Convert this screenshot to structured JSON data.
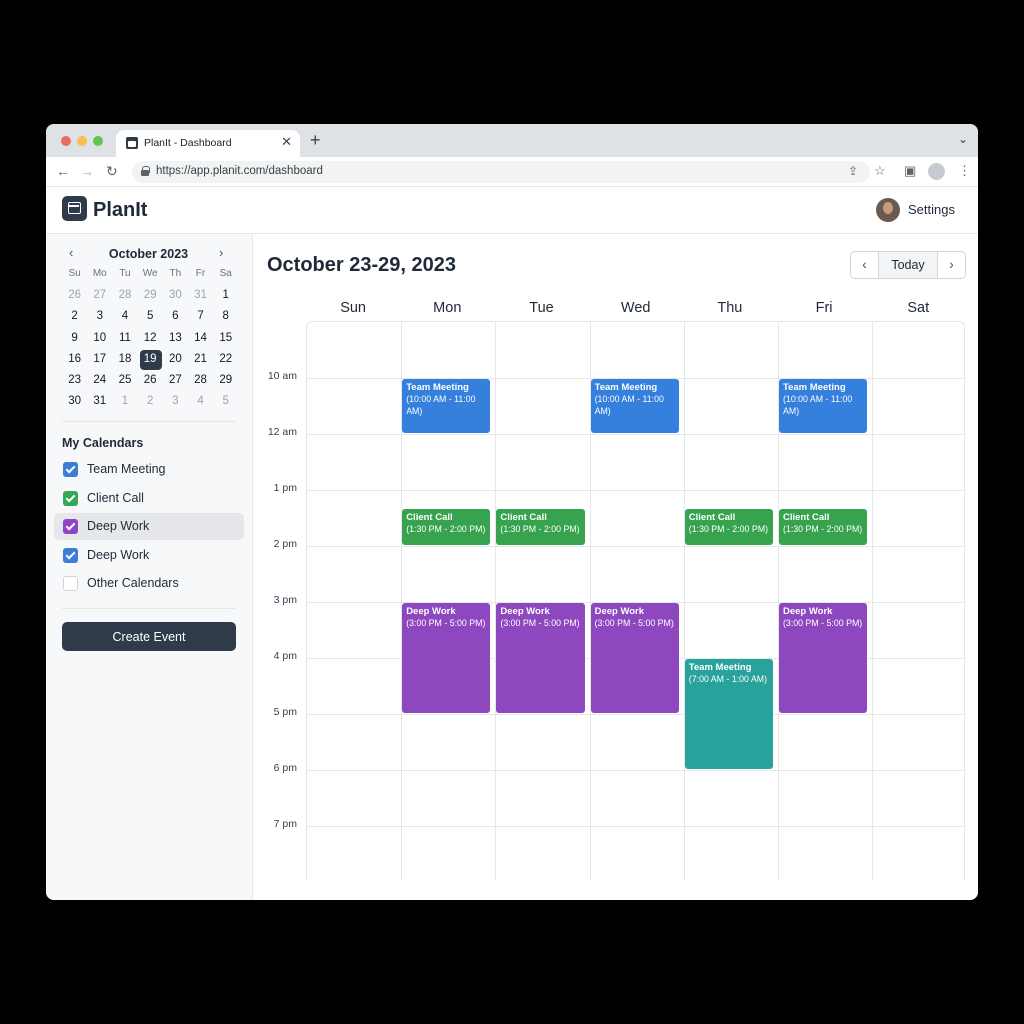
{
  "browser": {
    "tab_title": "PlanIt - Dashboard",
    "tab_close": "✕",
    "new_tab": "+",
    "tab_menu": "⌄",
    "url": "https://app.planit.com/dashboard",
    "back": "←",
    "forward": "→",
    "reload": "↻",
    "share": "⇪",
    "bookmark": "☆",
    "sidepanel": "▣",
    "menu": "⋮"
  },
  "app": {
    "name": "PlanIt",
    "settings_label": "Settings"
  },
  "mini_calendar": {
    "prev": "‹",
    "next": "›",
    "title": "October 2023",
    "weekdays": [
      "Su",
      "Mo",
      "Tu",
      "We",
      "Th",
      "Fr",
      "Sa"
    ],
    "days": [
      {
        "d": "26",
        "m": true
      },
      {
        "d": "27",
        "m": true
      },
      {
        "d": "28",
        "m": true
      },
      {
        "d": "29",
        "m": true
      },
      {
        "d": "30",
        "m": true
      },
      {
        "d": "31",
        "m": true
      },
      {
        "d": "1"
      },
      {
        "d": "2"
      },
      {
        "d": "3"
      },
      {
        "d": "4"
      },
      {
        "d": "5"
      },
      {
        "d": "6"
      },
      {
        "d": "7"
      },
      {
        "d": "8"
      },
      {
        "d": "9"
      },
      {
        "d": "10"
      },
      {
        "d": "11"
      },
      {
        "d": "12"
      },
      {
        "d": "13"
      },
      {
        "d": "14"
      },
      {
        "d": "15"
      },
      {
        "d": "16"
      },
      {
        "d": "17"
      },
      {
        "d": "18"
      },
      {
        "d": "19",
        "sel": true
      },
      {
        "d": "20"
      },
      {
        "d": "21"
      },
      {
        "d": "22"
      },
      {
        "d": "23"
      },
      {
        "d": "24"
      },
      {
        "d": "25"
      },
      {
        "d": "26"
      },
      {
        "d": "27"
      },
      {
        "d": "28"
      },
      {
        "d": "29"
      },
      {
        "d": "30"
      },
      {
        "d": "31"
      },
      {
        "d": "1",
        "m": true
      },
      {
        "d": "2",
        "m": true
      },
      {
        "d": "3",
        "m": true
      },
      {
        "d": "4",
        "m": true
      },
      {
        "d": "5",
        "m": true
      }
    ]
  },
  "calendars": {
    "title": "My Calendars",
    "items": [
      {
        "label": "Team Meeting",
        "color": "#3b7dd8",
        "checked": true,
        "active": false
      },
      {
        "label": "Client Call",
        "color": "#34a853",
        "checked": true,
        "active": false
      },
      {
        "label": "Deep Work",
        "color": "#8e44c4",
        "checked": true,
        "active": true
      },
      {
        "label": "Deep Work",
        "color": "#3b7dd8",
        "checked": true,
        "active": false
      },
      {
        "label": "Other Calendars",
        "color": "",
        "checked": false,
        "active": false
      }
    ]
  },
  "create_button": "Create Event",
  "week": {
    "title": "October 23-29, 2023",
    "prev": "‹",
    "today": "Today",
    "next": "›",
    "days": [
      "Sun",
      "Mon",
      "Tue",
      "Wed",
      "Thu",
      "Fri",
      "Sat"
    ],
    "time_labels": [
      "10 am",
      "12 am",
      "1 pm",
      "2 pm",
      "3 pm",
      "4 pm",
      "5 pm",
      "6 pm",
      "7 pm"
    ]
  },
  "events": [
    {
      "day": 1,
      "slot": 1,
      "span": 1,
      "title": "Team Meeting",
      "time": "(10:00 AM - 11:00 AM)",
      "color": "#3580dc"
    },
    {
      "day": 3,
      "slot": 1,
      "span": 1,
      "title": "Team Meeting",
      "time": "(10:00 AM - 11:00 AM)",
      "color": "#3580dc"
    },
    {
      "day": 5,
      "slot": 1,
      "span": 1,
      "title": "Team Meeting",
      "time": "(10:00 AM - 11:00 AM)",
      "color": "#3580dc"
    },
    {
      "day": 1,
      "slot": 3.33,
      "span": 0.67,
      "title": "Client Call",
      "time": "(1:30 PM - 2:00 PM)",
      "color": "#38a34f"
    },
    {
      "day": 2,
      "slot": 3.33,
      "span": 0.67,
      "title": "Client Call",
      "time": "(1:30 PM - 2:00 PM)",
      "color": "#38a34f"
    },
    {
      "day": 4,
      "slot": 3.33,
      "span": 0.67,
      "title": "Client Call",
      "time": "(1:30 PM - 2:00 PM)",
      "color": "#38a34f"
    },
    {
      "day": 5,
      "slot": 3.33,
      "span": 0.67,
      "title": "Client Call",
      "time": "(1:30 PM - 2:00 PM)",
      "color": "#38a34f"
    },
    {
      "day": 1,
      "slot": 5,
      "span": 2,
      "title": "Deep Work",
      "time": "(3:00 PM - 5:00 PM)",
      "color": "#8d48c0"
    },
    {
      "day": 2,
      "slot": 5,
      "span": 2,
      "title": "Deep Work",
      "time": "(3:00 PM - 5:00 PM)",
      "color": "#8d48c0"
    },
    {
      "day": 3,
      "slot": 5,
      "span": 2,
      "title": "Deep Work",
      "time": "(3:00 PM - 5:00 PM)",
      "color": "#8d48c0"
    },
    {
      "day": 5,
      "slot": 5,
      "span": 2,
      "title": "Deep Work",
      "time": "(3:00 PM - 5:00 PM)",
      "color": "#8d48c0"
    },
    {
      "day": 4,
      "slot": 6,
      "span": 2,
      "title": "Team Meeting",
      "time": "(7:00 AM - 1:00 AM)",
      "color": "#27a39b"
    }
  ]
}
